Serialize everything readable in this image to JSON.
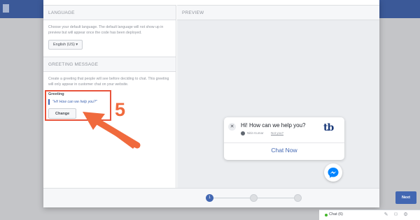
{
  "left": {
    "language_header": "LANGUAGE",
    "language_desc": "Choose your default language. The default language will not show up in preview but will appear once the code has been deployed.",
    "language_select": "English (US)",
    "greeting_header": "GREETING MESSAGE",
    "greeting_desc": "Create a greeting that people will see before deciding to chat. This greeting will only appear in customer chat on your website.",
    "greeting_label": "Greeting",
    "greeting_value": "\"Hi! How can we help you?\"",
    "change_button": "Change"
  },
  "annotation": {
    "step_number": "5",
    "color": "#e8543c"
  },
  "preview": {
    "header": "PREVIEW",
    "card": {
      "greeting": "Hi! How can we help you?",
      "name": "Nitin Kumar",
      "not_you": "Not you?",
      "logo": "tb",
      "chat_now": "Chat Now"
    }
  },
  "footer": {
    "steps": [
      "1",
      "",
      ""
    ],
    "active_step": 1,
    "next_button": "Next"
  },
  "chatbar": {
    "label": "Chat (6)"
  },
  "colors": {
    "brand": "#3b5998",
    "primary": "#4267b2",
    "accent": "#f06a3d"
  }
}
